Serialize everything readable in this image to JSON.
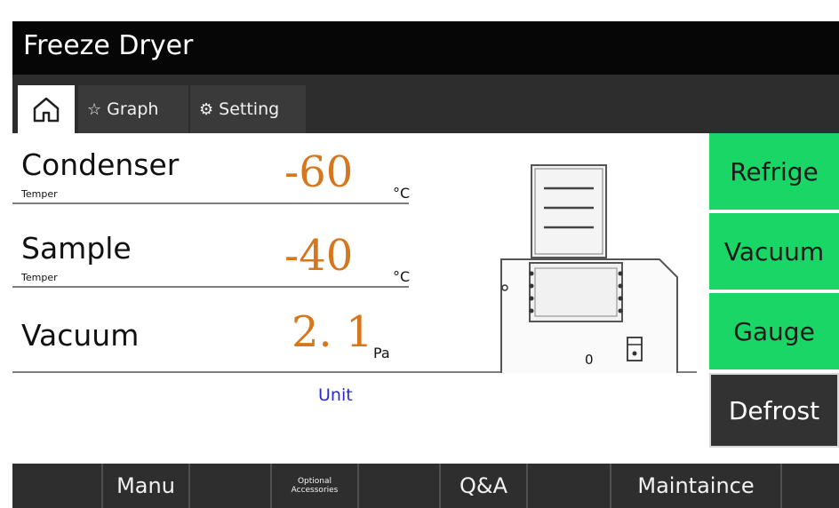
{
  "app": {
    "title": "Freeze Dryer"
  },
  "tabs": {
    "graph_label": "Graph",
    "setting_label": "Setting"
  },
  "readings": {
    "condenser": {
      "label": "Condenser",
      "sub": "Temper",
      "value": "-60",
      "unit": "°C"
    },
    "sample": {
      "label": "Sample",
      "sub": "Temper",
      "value": "-40",
      "unit": "°C"
    },
    "vacuum": {
      "label": "Vacuum",
      "value": "2. 1",
      "unit": "Pa"
    },
    "unit_button": "Unit"
  },
  "diagram": {
    "counter": "0"
  },
  "side_buttons": {
    "refrige": "Refrige",
    "vacuum": "Vacuum",
    "gauge": "Gauge",
    "defrost": "Defrost"
  },
  "bottom_nav": {
    "manu": "Manu",
    "optional_line1": "Optional",
    "optional_line2": "Accessories",
    "qa": "Q&A",
    "maintaince": "Maintaince"
  },
  "colors": {
    "accent_green": "#19d667",
    "value_orange": "#d4771f",
    "unit_blue": "#2a2ad4",
    "bar_dark": "#2e2e2e"
  },
  "icons": {
    "home": "home-icon",
    "graph": "star-icon",
    "setting": "gear-icon"
  }
}
